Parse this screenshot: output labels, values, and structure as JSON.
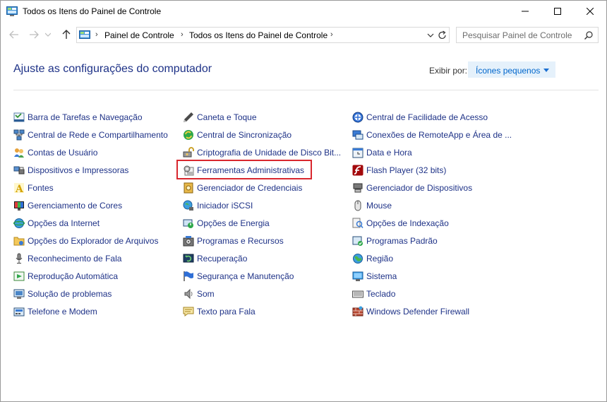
{
  "window": {
    "title": "Todos os Itens do Painel de Controle"
  },
  "address": {
    "crumbs": [
      "Painel de Controle",
      "Todos os Itens do Painel de Controle"
    ]
  },
  "search": {
    "placeholder": "Pesquisar Painel de Controle"
  },
  "header": {
    "title": "Ajuste as configurações do computador",
    "view_label": "Exibir por:",
    "view_value": "Ícones pequenos"
  },
  "columns": [
    [
      {
        "label": "Barra de Tarefas e Navegação",
        "icon": "taskbar-icon"
      },
      {
        "label": "Central de Rede e Compartilhamento",
        "icon": "network-icon"
      },
      {
        "label": "Contas de Usuário",
        "icon": "users-icon"
      },
      {
        "label": "Dispositivos e Impressoras",
        "icon": "printer-icon"
      },
      {
        "label": "Fontes",
        "icon": "fonts-icon"
      },
      {
        "label": "Gerenciamento de Cores",
        "icon": "color-monitor-icon"
      },
      {
        "label": "Opções da Internet",
        "icon": "globe-icon"
      },
      {
        "label": "Opções do Explorador de Arquivos",
        "icon": "folder-icon"
      },
      {
        "label": "Reconhecimento de Fala",
        "icon": "microphone-icon"
      },
      {
        "label": "Reprodução Automática",
        "icon": "autoplay-icon"
      },
      {
        "label": "Solução de problemas",
        "icon": "troubleshoot-icon"
      },
      {
        "label": "Telefone e Modem",
        "icon": "phone-icon"
      }
    ],
    [
      {
        "label": "Caneta e Toque",
        "icon": "pen-icon"
      },
      {
        "label": "Central de Sincronização",
        "icon": "sync-icon"
      },
      {
        "label": "Criptografia de Unidade de Disco Bit...",
        "icon": "bitlocker-icon"
      },
      {
        "label": "Ferramentas Administrativas",
        "icon": "admin-tools-icon"
      },
      {
        "label": "Gerenciador de Credenciais",
        "icon": "credentials-icon"
      },
      {
        "label": "Iniciador iSCSI",
        "icon": "iscsi-icon"
      },
      {
        "label": "Opções de Energia",
        "icon": "power-icon"
      },
      {
        "label": "Programas e Recursos",
        "icon": "programs-icon"
      },
      {
        "label": "Recuperação",
        "icon": "recovery-icon"
      },
      {
        "label": "Segurança e Manutenção",
        "icon": "flag-icon"
      },
      {
        "label": "Som",
        "icon": "speaker-icon"
      },
      {
        "label": "Texto para Fala",
        "icon": "speech-icon"
      }
    ],
    [
      {
        "label": "Central de Facilidade de Acesso",
        "icon": "accessibility-icon"
      },
      {
        "label": "Conexões de RemoteApp e Área de ...",
        "icon": "remoteapp-icon"
      },
      {
        "label": "Data e Hora",
        "icon": "clock-icon"
      },
      {
        "label": "Flash Player (32 bits)",
        "icon": "flash-icon"
      },
      {
        "label": "Gerenciador de Dispositivos",
        "icon": "device-manager-icon"
      },
      {
        "label": "Mouse",
        "icon": "mouse-icon"
      },
      {
        "label": "Opções de Indexação",
        "icon": "indexing-icon"
      },
      {
        "label": "Programas Padrão",
        "icon": "default-programs-icon"
      },
      {
        "label": "Região",
        "icon": "region-icon"
      },
      {
        "label": "Sistema",
        "icon": "system-icon"
      },
      {
        "label": "Teclado",
        "icon": "keyboard-icon"
      },
      {
        "label": "Windows Defender Firewall",
        "icon": "firewall-icon"
      }
    ]
  ],
  "highlighted_item": "Ferramentas Administrativas",
  "colors": {
    "link": "#1e3287",
    "highlight_border": "#d9272e",
    "view_select_bg": "#e5f1fb"
  }
}
